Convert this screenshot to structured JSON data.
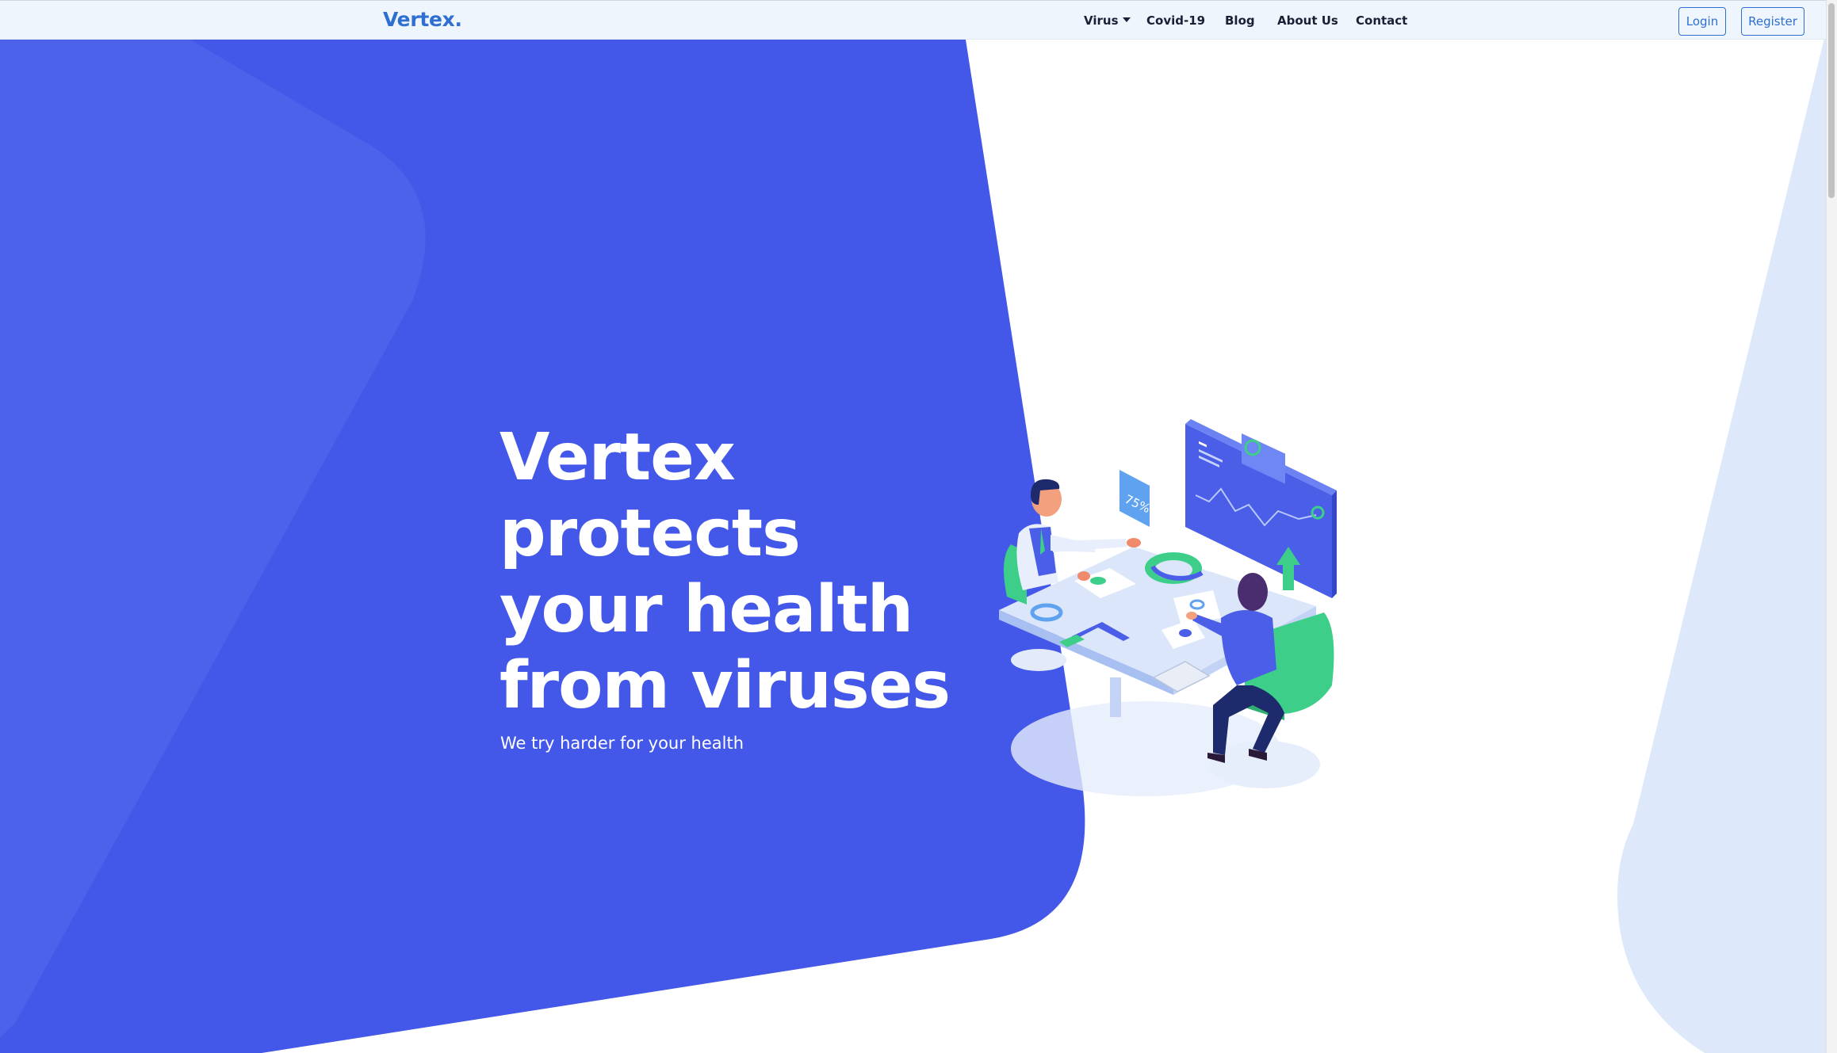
{
  "brand": {
    "name": "Vertex."
  },
  "nav": {
    "items": [
      {
        "label": "Virus",
        "has_dropdown": true
      },
      {
        "label": "Covid-19"
      },
      {
        "label": "Blog"
      },
      {
        "label": "About Us"
      },
      {
        "label": "Contact"
      }
    ],
    "login_label": "Login",
    "register_label": "Register"
  },
  "hero": {
    "title_lines": [
      "Vertex",
      "protects",
      "your health",
      "from viruses"
    ],
    "subtitle": "We try harder for your health"
  },
  "illustration": {
    "badge_text": "75%"
  },
  "colors": {
    "hero_blue": "#4358e8",
    "brand_blue": "#2f6fd1",
    "navbar_bg": "#eef5fd",
    "accent_green": "#3dcf8a",
    "light_blue_shape": "#dde9fb"
  }
}
